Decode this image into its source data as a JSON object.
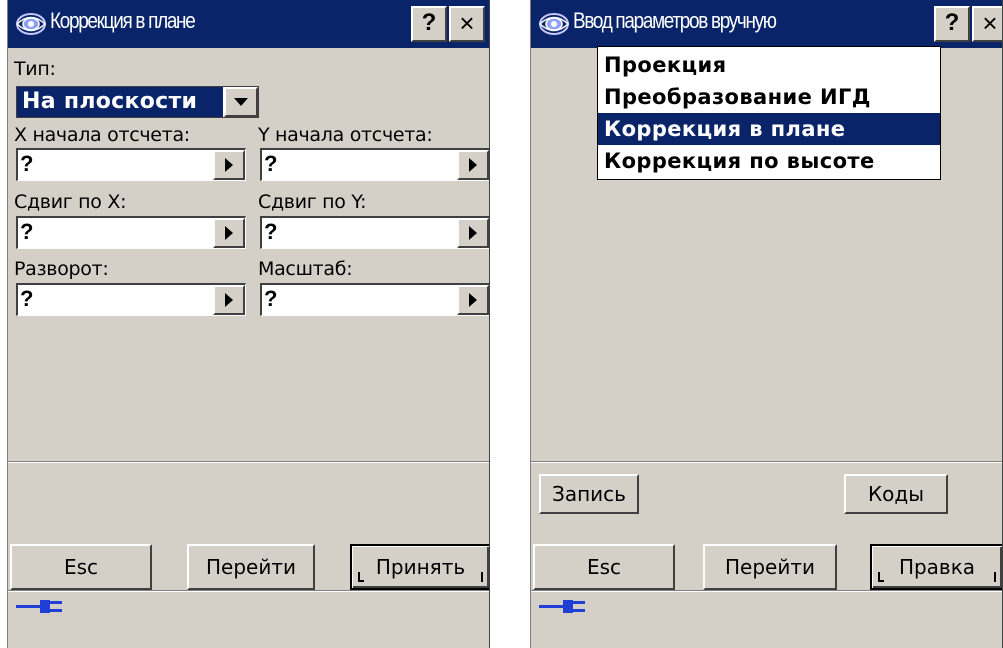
{
  "left_window": {
    "title": "Коррекция в плане",
    "help_label": "?",
    "close_label": "×",
    "type_label": "Тип:",
    "type_value": "На плоскости",
    "fields": [
      {
        "label": "X начала отсчета:",
        "value": "?"
      },
      {
        "label": "Y начала отсчета:",
        "value": "?"
      },
      {
        "label": "Сдвиг по X:",
        "value": "?"
      },
      {
        "label": "Сдвиг по Y:",
        "value": "?"
      },
      {
        "label": "Разворот:",
        "value": "?"
      },
      {
        "label": "Масштаб:",
        "value": "?"
      }
    ],
    "buttons": {
      "esc": "Esc",
      "go": "Перейти",
      "accept": "Принять"
    }
  },
  "right_window": {
    "title": "Ввод параметров вручную",
    "help_label": "?",
    "close_label": "×",
    "menu_items": [
      {
        "label": "Проекция",
        "selected": false
      },
      {
        "label": "Преобразование ИГД",
        "selected": false
      },
      {
        "label": "Коррекция в плане",
        "selected": true
      },
      {
        "label": "Коррекция по высоте",
        "selected": false
      }
    ],
    "buttons": {
      "record": "Запись",
      "codes": "Коды",
      "esc": "Esc",
      "go": "Перейти",
      "edit": "Правка"
    }
  },
  "colors": {
    "titlebar": "#0a246a",
    "face": "#d4d0c8",
    "selection": "#0a246a",
    "plug": "#1f3fd6"
  },
  "icons": [
    "app-logo-icon",
    "help-icon",
    "close-icon",
    "dropdown-arrow-icon",
    "arrow-right-icon",
    "power-plug-icon"
  ]
}
